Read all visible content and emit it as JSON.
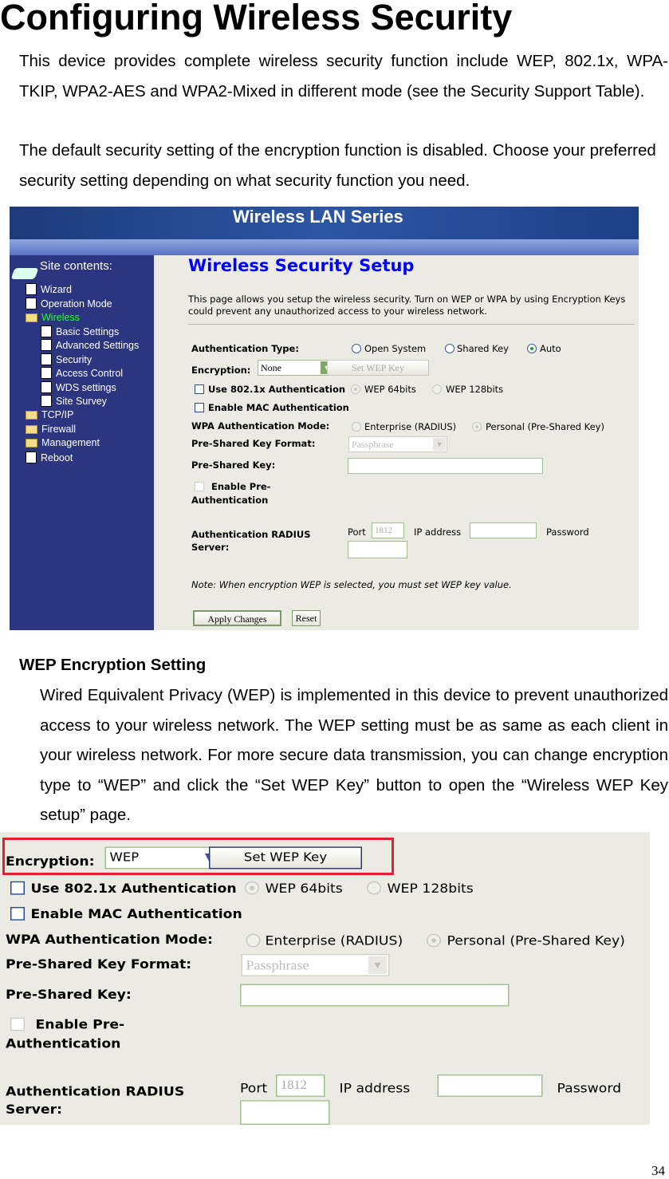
{
  "title": "Configuring Wireless Security",
  "intro": [
    "This device provides complete wireless security function include WEP, 802.1x, WPA-TKIP, WPA2-AES and WPA2-Mixed in different mode (see the Security Support Table).",
    "The default security setting of the encryption function is disabled. Choose your preferred security setting depending on what security function you need."
  ],
  "shot1": {
    "banner_title": "Wireless LAN Series",
    "site_contents": "Site contents:",
    "sidebar": [
      {
        "label": "Wizard",
        "icon": "doc"
      },
      {
        "label": "Operation Mode",
        "icon": "doc"
      },
      {
        "label": "Wireless",
        "icon": "folder-open",
        "active": true
      },
      {
        "label": "Basic Settings",
        "icon": "doc"
      },
      {
        "label": "Advanced Settings",
        "icon": "doc"
      },
      {
        "label": "Security",
        "icon": "doc"
      },
      {
        "label": "Access Control",
        "icon": "doc"
      },
      {
        "label": "WDS settings",
        "icon": "doc"
      },
      {
        "label": "Site Survey",
        "icon": "doc"
      },
      {
        "label": "TCP/IP",
        "icon": "folder"
      },
      {
        "label": "Firewall",
        "icon": "folder"
      },
      {
        "label": "Management",
        "icon": "folder"
      },
      {
        "label": "Reboot",
        "icon": "doc"
      }
    ],
    "page_title": "Wireless Security Setup",
    "description": "This page allows you setup the wireless security. Turn on WEP or WPA by using Encryption Keys could prevent any unauthorized access to your wireless network.",
    "accent": "#0000ff"
  },
  "form": {
    "auth_type_label": "Authentication Type:",
    "auth_open": "Open System",
    "auth_shared": "Shared Key",
    "auth_auto": "Auto",
    "encryption_label": "Encryption:",
    "encryption_value_1": "None",
    "encryption_value_2": "WEP",
    "set_wep_key": "Set WEP Key",
    "use_8021x": "Use 802.1x Authentication",
    "wep64": "WEP 64bits",
    "wep128": "WEP 128bits",
    "enable_mac": "Enable MAC Authentication",
    "wpa_mode_label": "WPA Authentication Mode:",
    "enterprise": "Enterprise (RADIUS)",
    "personal": "Personal (Pre-Shared Key)",
    "psk_format_label": "Pre-Shared Key Format:",
    "psk_format_value": "Passphrase",
    "psk_label": "Pre-Shared Key:",
    "enable_pre": "Enable Pre-",
    "authentication": "Authentication",
    "radius_label_1": "Authentication RADIUS",
    "radius_label_2": "Server:",
    "port_label": "Port",
    "port_value": "1812",
    "ip_label": "IP address",
    "password_label": "Password",
    "note": "Note: When encryption WEP is selected, you must set WEP key value.",
    "apply": "Apply Changes",
    "reset": "Reset"
  },
  "section_heading": "WEP Encryption Setting",
  "section_text": "Wired Equivalent Privacy (WEP) is implemented in this device to prevent unauthorized access to your wireless network. The WEP setting must be as same as each client in your wireless network. For more secure data transmission, you can change encryption type to “WEP” and click the “Set WEP Key” button to open the “Wireless WEP Key setup” page.",
  "highlight_color": "#e8202a",
  "page_number": "34"
}
